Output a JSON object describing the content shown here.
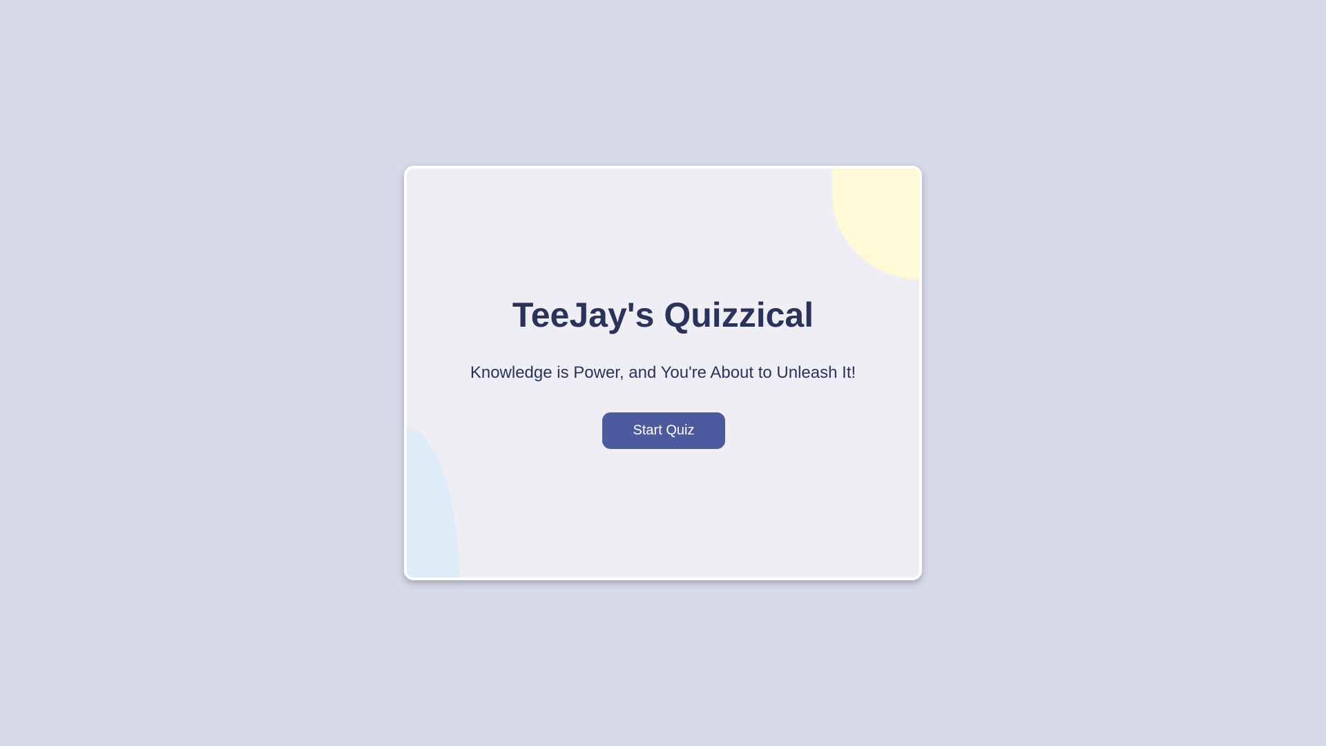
{
  "page": {
    "title": "TeeJay's Quizzical",
    "subtitle": "Knowledge is Power, and You're About to Unleash It!",
    "start_button_label": "Start Quiz"
  },
  "colors": {
    "background": "#d8dae7",
    "card_background": "#eeeef4",
    "text": "#2b335a",
    "button": "#4d5b9e",
    "blob_yellow": "#fff9d5",
    "blob_blue": "#deebf8"
  }
}
